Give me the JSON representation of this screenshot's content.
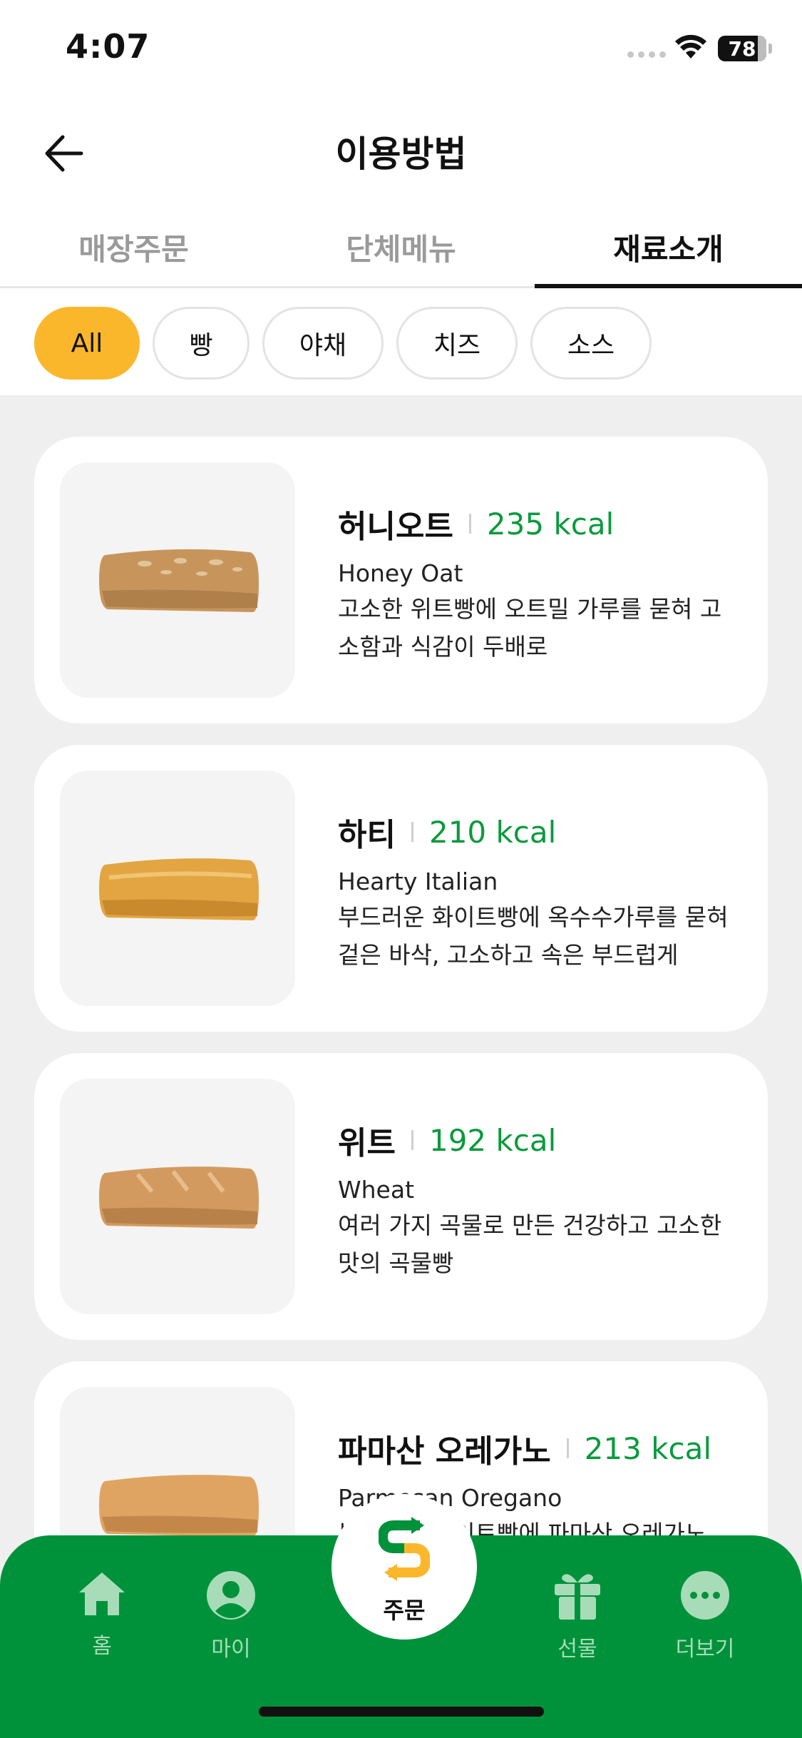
{
  "status_bar": {
    "time": "4:07",
    "battery": "78"
  },
  "header": {
    "title": "이용방법"
  },
  "tabs": [
    {
      "label": "매장주문",
      "active": false
    },
    {
      "label": "단체메뉴",
      "active": false
    },
    {
      "label": "재료소개",
      "active": true
    }
  ],
  "filters": [
    {
      "label": "All",
      "active": true
    },
    {
      "label": "빵",
      "active": false
    },
    {
      "label": "야채",
      "active": false
    },
    {
      "label": "치즈",
      "active": false
    },
    {
      "label": "소스",
      "active": false
    }
  ],
  "items": [
    {
      "name": "허니오트",
      "kcal": "235 kcal",
      "english": "Honey Oat",
      "desc1": "고소한 위트빵에 오트밀 가루를 묻혀 고",
      "desc2": "소함과 식감이 두배로"
    },
    {
      "name": "하티",
      "kcal": "210 kcal",
      "english": "Hearty Italian",
      "desc1": "부드러운 화이트빵에 옥수수가루를 묻혀",
      "desc2": "겉은 바삭, 고소하고 속은 부드럽게"
    },
    {
      "name": "위트",
      "kcal": "192 kcal",
      "english": "Wheat",
      "desc1": "여러 가지 곡물로 만든 건강하고 고소한",
      "desc2": "맛의 곡물빵"
    },
    {
      "name": "파마산 오레가노",
      "kcal": "213 kcal",
      "english": "Parmesan Oregano",
      "desc1": "부드러운 화이트빵에 파마산 오레가노",
      "desc2": ""
    }
  ],
  "nav": {
    "home": "홈",
    "my": "마이",
    "order": "주문",
    "gift": "선물",
    "more": "더보기"
  },
  "colors": {
    "accent_green": "#00923b",
    "chip_active": "#fbb72c",
    "kcal_green": "#0a9a3c"
  }
}
